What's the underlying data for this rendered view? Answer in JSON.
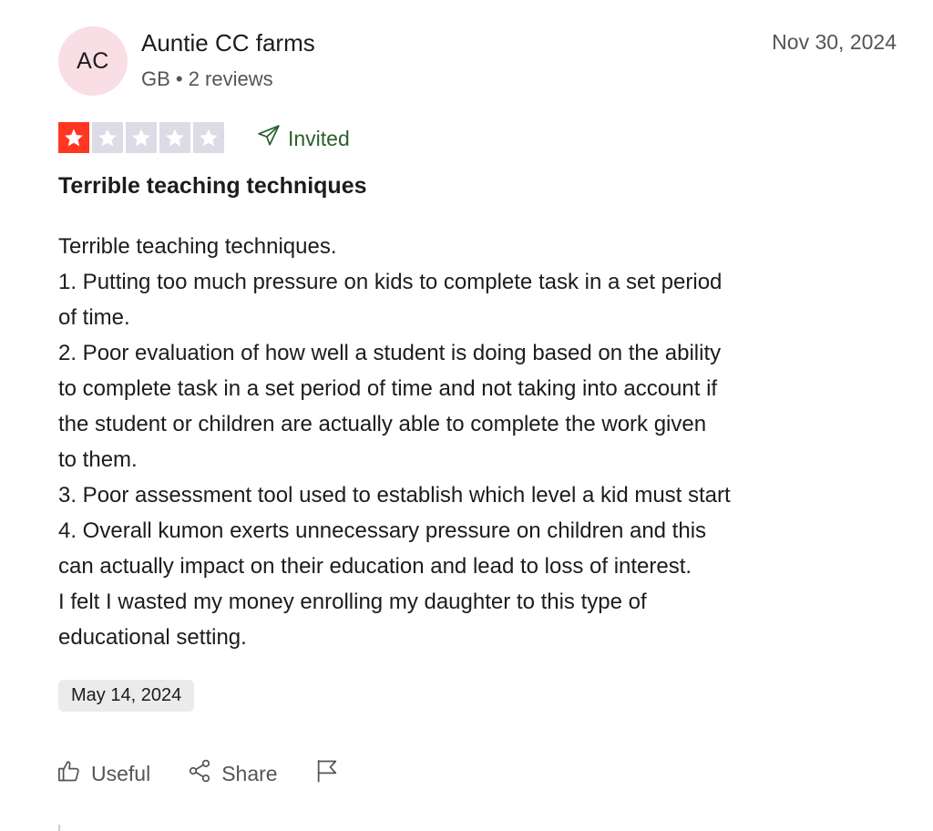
{
  "reviewer": {
    "initials": "AC",
    "name": "Auntie CC farms",
    "meta": "GB • 2 reviews",
    "avatar_color": "#fadee5"
  },
  "review_date": "Nov 30, 2024",
  "rating": {
    "value": 1,
    "max": 5,
    "filled_color": "#ff3722",
    "empty_color": "#dcdce6"
  },
  "invited_label": "Invited",
  "review_title": "Terrible teaching techniques",
  "body_lines": [
    "Terrible teaching techniques.",
    "1. Putting too much pressure on kids to complete task in a set period",
    "of time.",
    "2. Poor evaluation of how well a student is doing based on the ability",
    "to complete task in a set period of time and not taking into account if",
    "the student or children are actually able to complete the work given",
    "to them.",
    "3. Poor assessment tool used to establish which level a kid must start",
    "4. Overall kumon exerts unnecessary pressure on children and this",
    "can actually impact on their education and lead to loss of interest.",
    "I felt I wasted my money enrolling my daughter to this type of",
    "educational setting."
  ],
  "experience_date": "May 14, 2024",
  "actions": {
    "useful_label": "Useful",
    "share_label": "Share",
    "useful_icon": "thumbs-up-icon",
    "share_icon": "share-icon",
    "flag_icon": "flag-icon"
  }
}
